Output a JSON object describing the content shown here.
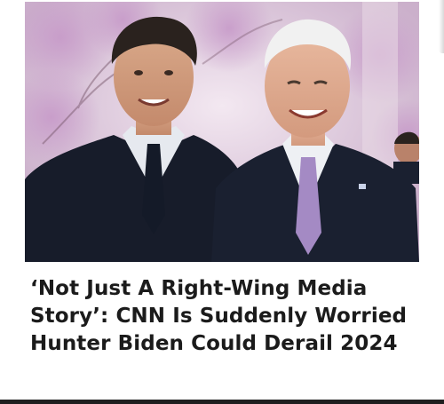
{
  "article": {
    "image_alt": "Hunter Biden and Joe Biden smiling together",
    "headline": "‘Not Just A Right-Wing Media Story’: CNN Is Suddenly Worried Hunter Biden Could Derail 2024"
  },
  "colors": {
    "headline_text": "#1b1b1b",
    "background": "#ffffff",
    "photo_backdrop": "#e4d3e4",
    "suit_dark": "#171c2a",
    "tie_purple": "#a48ac4"
  }
}
